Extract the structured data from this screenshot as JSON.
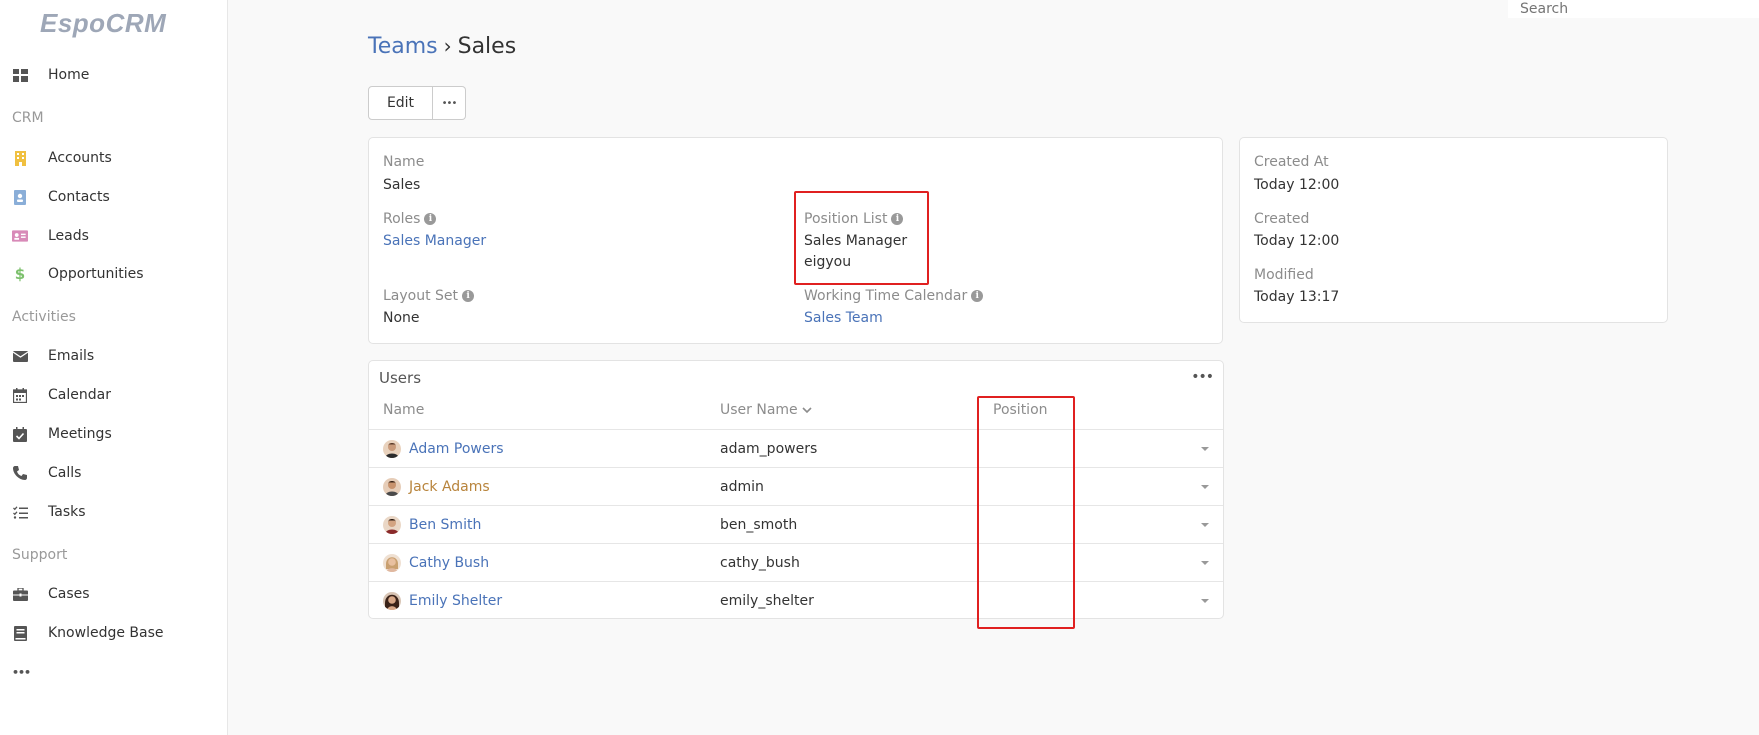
{
  "logo": {
    "text": "EspoCRM"
  },
  "search": {
    "placeholder": "Search"
  },
  "sidebar": {
    "home": "Home",
    "groups": {
      "crm": "CRM",
      "activities": "Activities",
      "support": "Support"
    },
    "items": {
      "accounts": "Accounts",
      "contacts": "Contacts",
      "leads": "Leads",
      "opportunities": "Opportunities",
      "emails": "Emails",
      "calendar": "Calendar",
      "meetings": "Meetings",
      "calls": "Calls",
      "tasks": "Tasks",
      "cases": "Cases",
      "knowledge_base": "Knowledge Base"
    },
    "more": "•••"
  },
  "breadcrumb": {
    "parent": "Teams",
    "separator": "›",
    "current": "Sales"
  },
  "toolbar": {
    "edit_label": "Edit",
    "more_label": "•••"
  },
  "detail": {
    "name_label": "Name",
    "name_value": "Sales",
    "roles_label": "Roles",
    "roles_value": "Sales Manager",
    "position_list_label": "Position List",
    "position_list_values": [
      "Sales Manager",
      "eigyou"
    ],
    "layout_set_label": "Layout Set",
    "layout_set_value": "None",
    "working_time_calendar_label": "Working Time Calendar",
    "working_time_calendar_value": "Sales Team"
  },
  "side_panel": {
    "created_at_label": "Created At",
    "created_at_value": "Today 12:00",
    "created_label": "Created",
    "created_value": "Today 12:00",
    "modified_label": "Modified",
    "modified_value": "Today 13:17"
  },
  "users": {
    "title": "Users",
    "menu": "•••",
    "columns": {
      "name": "Name",
      "user_name": "User Name",
      "position": "Position"
    },
    "rows": [
      {
        "name": "Adam Powers",
        "user_name": "adam_powers",
        "position": ""
      },
      {
        "name": "Jack Adams",
        "user_name": "admin",
        "position": ""
      },
      {
        "name": "Ben Smith",
        "user_name": "ben_smoth",
        "position": ""
      },
      {
        "name": "Cathy Bush",
        "user_name": "cathy_bush",
        "position": ""
      },
      {
        "name": "Emily Shelter",
        "user_name": "emily_shelter",
        "position": ""
      }
    ]
  },
  "colors": {
    "link": "#4a73b8",
    "admin_link": "#b8843c",
    "highlight": "#e02020",
    "accounts_icon": "#f0c040",
    "contacts_icon": "#8aaed8",
    "leads_icon": "#d88ab8",
    "opportunities_icon": "#7cc06c"
  }
}
